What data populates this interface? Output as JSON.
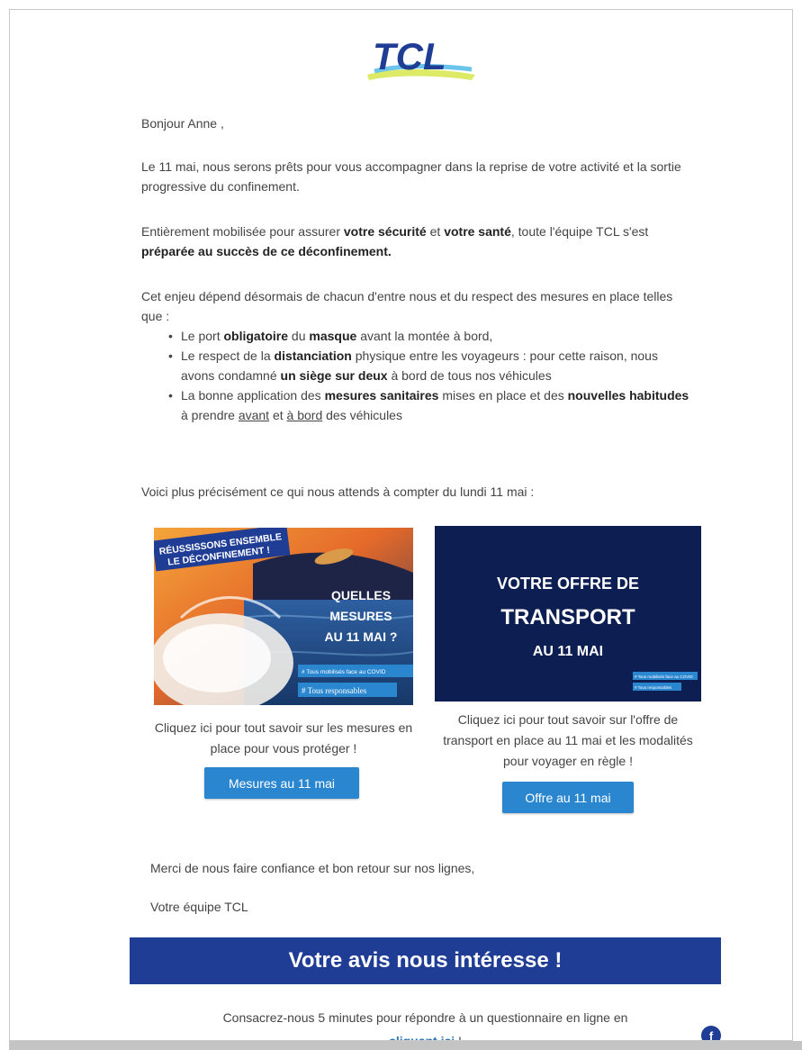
{
  "logo": {
    "text": "TCL"
  },
  "greeting": "Bonjour Anne ,",
  "intro": "Le 11 mai, nous serons prêts pour vous accompagner dans la reprise de votre activité et la sortie progressive du confinement.",
  "mobilisation": {
    "p1": "Entièrement mobilisée pour assurer ",
    "b1": "votre sécurité",
    "p2": " et ",
    "b2": "votre santé",
    "p3": ", toute l'équipe TCL s'est ",
    "b3": "préparée au succès de ce déconfinement."
  },
  "enjeu": "Cet enjeu dépend désormais de chacun d'entre nous et du respect des mesures en place telles que :",
  "measures": [
    {
      "t1": "Le port ",
      "b1": "obligatoire",
      "t2": " du ",
      "b2": "masque",
      "t3": " avant la montée à bord,"
    },
    {
      "t1": "Le respect de la ",
      "b1": "distanciation",
      "t2": " physique entre les voyageurs : pour cette raison, nous avons condamné ",
      "b2": "un siège sur deux",
      "t3": " à bord de tous nos véhicules"
    },
    {
      "t1": "La bonne application des ",
      "b1": "mesures sanitaires",
      "t2": " mises en place et des ",
      "b2": "nouvelles habitudes",
      "t3": " à prendre ",
      "u1": "avant",
      "t4": " et ",
      "u2": "à bord",
      "t5": " des véhicules"
    }
  ],
  "voici": "Voici plus précisément ce qui nous attends à compter du lundi 11 mai :",
  "promo_left": {
    "banner": "RÉUSSISSONS ENSEMBLE\nLE DÉCONFINEMENT !",
    "line1": "QUELLES",
    "line2": "MESURES",
    "line3": "AU 11 MAI ?",
    "tag1": "# Tous mobilisés face au COVID",
    "tag2": "# Tous responsables",
    "caption": "Cliquez ici pour tout savoir sur les mesures en place pour vous protéger !",
    "button": "Mesures au 11 mai"
  },
  "promo_right": {
    "line1": "VOTRE OFFRE DE",
    "line2": "TRANSPORT",
    "line3": "AU 11 MAI",
    "tag1": "# Tous mobilisés face au COVID",
    "tag2": "# Tous responsables",
    "caption": "Cliquez ici pour tout savoir sur l'offre de transport en place au 11 mai et les modalités pour voyager en règle !",
    "button": "Offre au 11 mai"
  },
  "merci": "Merci de nous faire confiance et bon retour sur nos lignes,",
  "signature": "Votre équipe TCL",
  "avis_banner": "Votre avis nous intéresse !",
  "survey": {
    "text": "Consacrez-nous 5 minutes pour répondre à un questionnaire en ligne en",
    "link": "cliquant ici",
    "after": " !"
  },
  "facebook_icon": "f",
  "colors": {
    "brand_blue": "#1f3d94",
    "button_blue": "#2b86d0",
    "navy": "#0c1e52"
  }
}
